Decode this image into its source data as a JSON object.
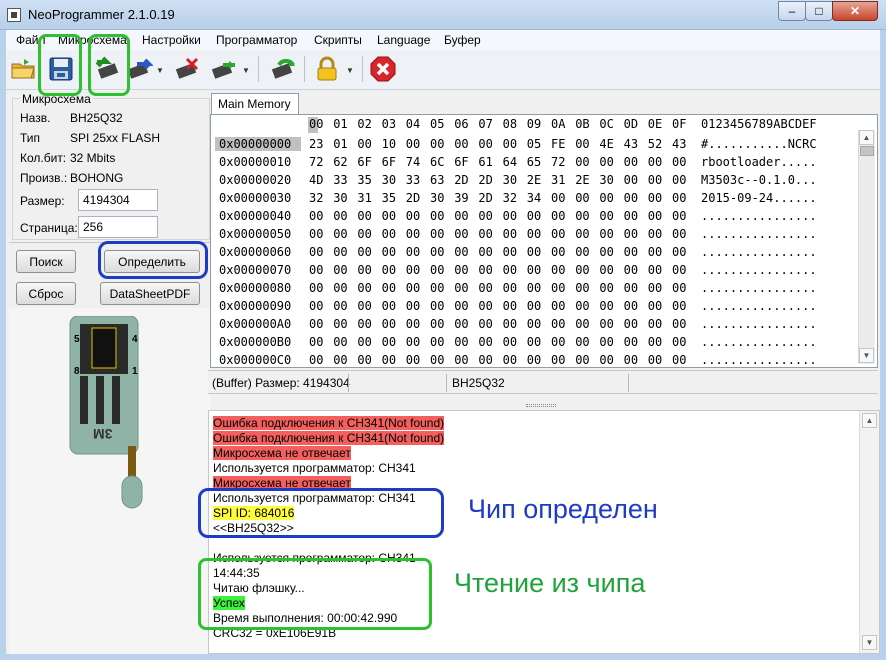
{
  "window": {
    "title": "NeoProgrammer 2.1.0.19",
    "minimize": "–",
    "maximize": "□",
    "close": "✕"
  },
  "menu": [
    "Файл",
    "Микросхема",
    "Настройки",
    "Программатор",
    "Скрипты",
    "Language",
    "Буфер"
  ],
  "chip_info": {
    "group_title": "Микросхема",
    "name_label": "Назв.",
    "name_value": "BH25Q32",
    "type_label": "Тип",
    "type_value": "SPI 25xx FLASH",
    "bits_label": "Кол.бит:",
    "bits_value": "32 Mbits",
    "maker_label": "Произв.:",
    "maker_value": "BOHONG",
    "size_label": "Размер:",
    "size_value": "4194304",
    "page_label": "Страница:",
    "page_value": "256"
  },
  "buttons": {
    "search": "Поиск",
    "detect": "Определить",
    "reset": "Сброс",
    "datasheet": "DataSheetPDF"
  },
  "socket": {
    "label": "3M",
    "pin_5": "5",
    "pin_4": "4",
    "pin_8": "8",
    "pin_1": "1"
  },
  "hex": {
    "tab": "Main Memory",
    "columns": [
      "00",
      "01",
      "02",
      "03",
      "04",
      "05",
      "06",
      "07",
      "08",
      "09",
      "0A",
      "0B",
      "0C",
      "0D",
      "0E",
      "0F"
    ],
    "ascii_header": "0123456789ABCDEF",
    "rows": [
      {
        "addr": "0x00000000",
        "bytes": [
          "23",
          "01",
          "00",
          "10",
          "00",
          "00",
          "00",
          "00",
          "00",
          "05",
          "FE",
          "00",
          "4E",
          "43",
          "52",
          "43"
        ],
        "ascii": "#...........NCRC"
      },
      {
        "addr": "0x00000010",
        "bytes": [
          "72",
          "62",
          "6F",
          "6F",
          "74",
          "6C",
          "6F",
          "61",
          "64",
          "65",
          "72",
          "00",
          "00",
          "00",
          "00",
          "00"
        ],
        "ascii": "rbootloader....."
      },
      {
        "addr": "0x00000020",
        "bytes": [
          "4D",
          "33",
          "35",
          "30",
          "33",
          "63",
          "2D",
          "2D",
          "30",
          "2E",
          "31",
          "2E",
          "30",
          "00",
          "00",
          "00"
        ],
        "ascii": "M3503c--0.1.0..."
      },
      {
        "addr": "0x00000030",
        "bytes": [
          "32",
          "30",
          "31",
          "35",
          "2D",
          "30",
          "39",
          "2D",
          "32",
          "34",
          "00",
          "00",
          "00",
          "00",
          "00",
          "00"
        ],
        "ascii": "2015-09-24......"
      },
      {
        "addr": "0x00000040",
        "bytes": [
          "00",
          "00",
          "00",
          "00",
          "00",
          "00",
          "00",
          "00",
          "00",
          "00",
          "00",
          "00",
          "00",
          "00",
          "00",
          "00"
        ],
        "ascii": "................"
      },
      {
        "addr": "0x00000050",
        "bytes": [
          "00",
          "00",
          "00",
          "00",
          "00",
          "00",
          "00",
          "00",
          "00",
          "00",
          "00",
          "00",
          "00",
          "00",
          "00",
          "00"
        ],
        "ascii": "................"
      },
      {
        "addr": "0x00000060",
        "bytes": [
          "00",
          "00",
          "00",
          "00",
          "00",
          "00",
          "00",
          "00",
          "00",
          "00",
          "00",
          "00",
          "00",
          "00",
          "00",
          "00"
        ],
        "ascii": "................"
      },
      {
        "addr": "0x00000070",
        "bytes": [
          "00",
          "00",
          "00",
          "00",
          "00",
          "00",
          "00",
          "00",
          "00",
          "00",
          "00",
          "00",
          "00",
          "00",
          "00",
          "00"
        ],
        "ascii": "................"
      },
      {
        "addr": "0x00000080",
        "bytes": [
          "00",
          "00",
          "00",
          "00",
          "00",
          "00",
          "00",
          "00",
          "00",
          "00",
          "00",
          "00",
          "00",
          "00",
          "00",
          "00"
        ],
        "ascii": "................"
      },
      {
        "addr": "0x00000090",
        "bytes": [
          "00",
          "00",
          "00",
          "00",
          "00",
          "00",
          "00",
          "00",
          "00",
          "00",
          "00",
          "00",
          "00",
          "00",
          "00",
          "00"
        ],
        "ascii": "................"
      },
      {
        "addr": "0x000000A0",
        "bytes": [
          "00",
          "00",
          "00",
          "00",
          "00",
          "00",
          "00",
          "00",
          "00",
          "00",
          "00",
          "00",
          "00",
          "00",
          "00",
          "00"
        ],
        "ascii": "................"
      },
      {
        "addr": "0x000000B0",
        "bytes": [
          "00",
          "00",
          "00",
          "00",
          "00",
          "00",
          "00",
          "00",
          "00",
          "00",
          "00",
          "00",
          "00",
          "00",
          "00",
          "00"
        ],
        "ascii": "................"
      },
      {
        "addr": "0x000000C0",
        "bytes": [
          "00",
          "00",
          "00",
          "00",
          "00",
          "00",
          "00",
          "00",
          "00",
          "00",
          "00",
          "00",
          "00",
          "00",
          "00",
          "00"
        ],
        "ascii": "................"
      }
    ]
  },
  "status": {
    "buffer_size": "(Buffer) Размер: 4194304",
    "chip": "BH25Q32"
  },
  "log": [
    {
      "text": "Ошибка подключения к CH341(Not found)",
      "style": "red"
    },
    {
      "text": "Ошибка подключения к CH341(Not found)",
      "style": "red"
    },
    {
      "text": "Микросхема не отвечает",
      "style": "red"
    },
    {
      "text": "Используется программатор: CH341",
      "style": "none"
    },
    {
      "text": "Микросхема не отвечает",
      "style": "red"
    },
    {
      "text": "Используется программатор: CH341",
      "style": "none"
    },
    {
      "text": "SPI ID: 684016",
      "style": "yellow"
    },
    {
      "text": "<<BH25Q32>>",
      "style": "none"
    },
    {
      "text": "",
      "style": "none"
    },
    {
      "text": "Используется программатор: CH341",
      "style": "none"
    },
    {
      "text": "14:44:35",
      "style": "none"
    },
    {
      "text": "Читаю флэшку...",
      "style": "none"
    },
    {
      "text": "Успех",
      "style": "green"
    },
    {
      "text": "Время выполнения: 00:00:42.990",
      "style": "none"
    },
    {
      "text": "CRC32 = 0xE106E91B",
      "style": "none"
    }
  ],
  "annotations": {
    "chip_detected": "Чип определен",
    "read_from_chip": "Чтение из чипа"
  },
  "colors": {
    "error": "#f25f5c",
    "id_highlight": "#fdfd3a",
    "success": "#3cf23c",
    "annotation_blue": "#1e3ac9",
    "annotation_green": "#1fa33a"
  },
  "icons": [
    "open-folder-icon",
    "save-icon",
    "read-chip-icon",
    "write-chip-icon",
    "erase-chip-icon",
    "verify-chip-icon",
    "auto-chip-icon",
    "lock-icon",
    "stop-icon"
  ]
}
